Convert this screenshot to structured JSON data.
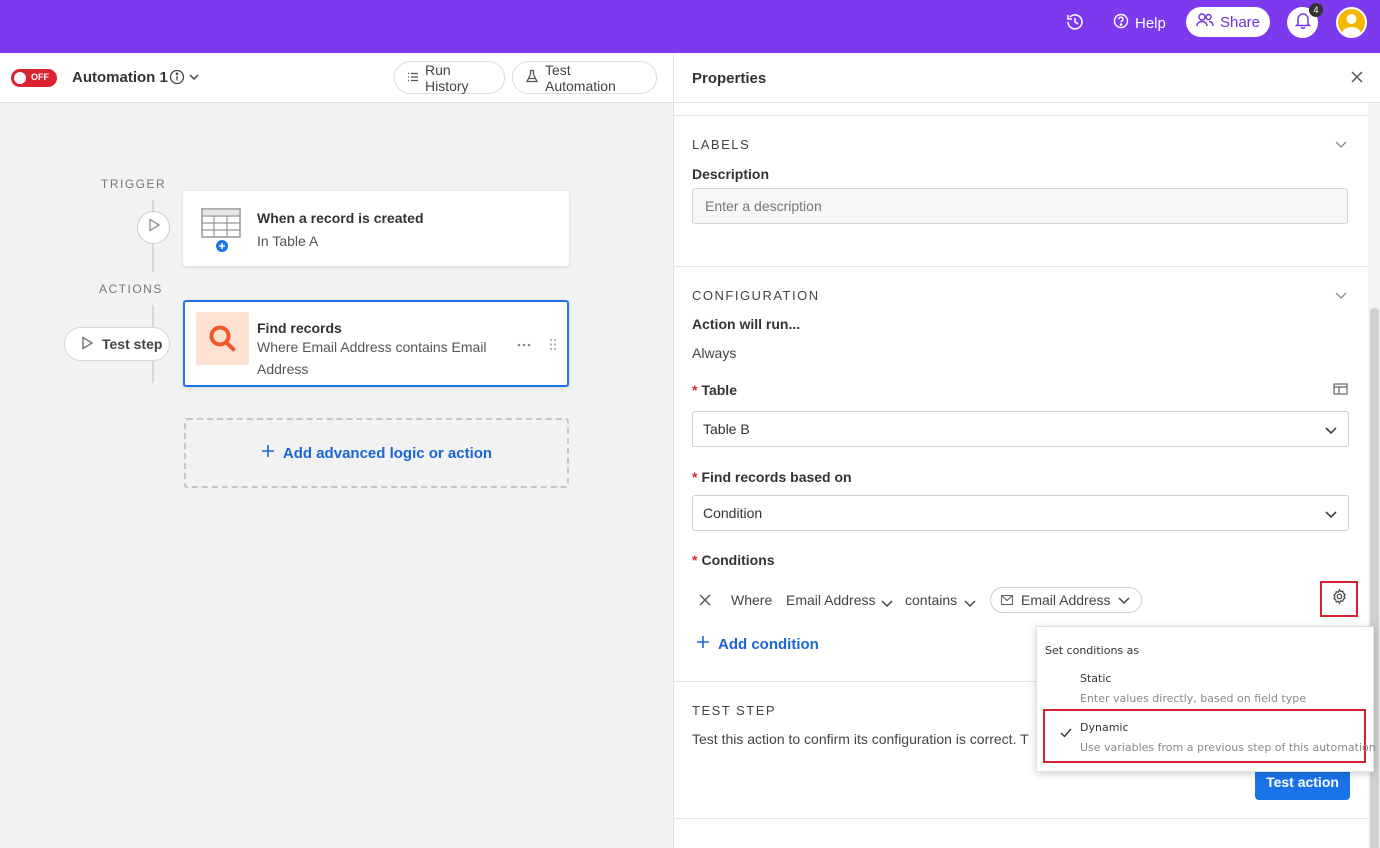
{
  "colors": {
    "brand": "#7c39ed",
    "accent": "#1a73e8",
    "danger": "#d9232e",
    "link": "#1a66d6"
  },
  "topbar": {
    "help_label": "Help",
    "share_label": "Share",
    "notification_count": "4",
    "icons": [
      "history-icon",
      "help-icon",
      "share-users-icon",
      "bell-icon",
      "avatar"
    ]
  },
  "automation": {
    "toggle_label": "OFF",
    "name": "Automation 1",
    "run_history_label": "Run History",
    "test_automation_label": "Test Automation"
  },
  "canvas": {
    "trigger_label": "TRIGGER",
    "actions_label": "ACTIONS",
    "test_step_label": "Test step",
    "trigger_card": {
      "title": "When a record is created",
      "subtitle": "In Table A"
    },
    "action_card": {
      "title": "Find records",
      "subtitle_line1": "Where Email Address contains Email",
      "subtitle_line2": "Address"
    },
    "add_logic_label": "Add advanced logic or action"
  },
  "panel": {
    "title": "Properties",
    "labels_section": {
      "title": "LABELS",
      "description_label": "Description",
      "description_placeholder": "Enter a description"
    },
    "config_section": {
      "title": "CONFIGURATION",
      "action_will_run_label": "Action will run...",
      "action_will_run_value": "Always",
      "table_label": "Table",
      "table_value": "Table B",
      "find_based_on_label": "Find records based on",
      "find_based_on_value": "Condition",
      "conditions_label": "Conditions",
      "condition": {
        "where": "Where",
        "field": "Email Address",
        "operator": "contains",
        "value": "Email Address"
      },
      "add_condition_label": "Add condition"
    },
    "test_section": {
      "title": "TEST STEP",
      "description": "Test this action to confirm its configuration is correct. T",
      "button_label": "Test action"
    }
  },
  "popover": {
    "heading": "Set conditions as",
    "options": [
      {
        "label": "Static",
        "description": "Enter values directly, based on field type",
        "selected": false
      },
      {
        "label": "Dynamic",
        "description": "Use variables from a previous step of this automation",
        "selected": true
      }
    ]
  }
}
